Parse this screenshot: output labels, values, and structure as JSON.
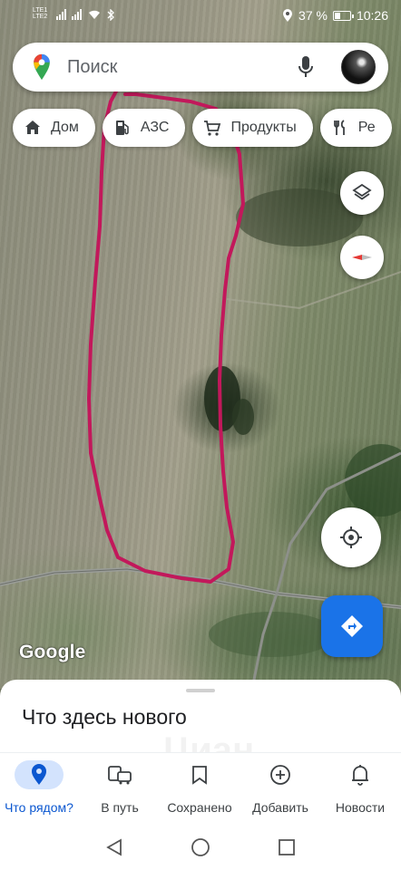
{
  "status_bar": {
    "sim1": "LTE1",
    "sim2": "LTE2",
    "battery": "37 %",
    "time": "10:26"
  },
  "search": {
    "placeholder": "Поиск"
  },
  "chips": [
    {
      "label": "Дом",
      "icon": "home-icon"
    },
    {
      "label": "АЗС",
      "icon": "gas-station-icon"
    },
    {
      "label": "Продукты",
      "icon": "cart-icon"
    },
    {
      "label": "Ре",
      "icon": "restaurant-icon"
    }
  ],
  "map": {
    "attribution": "Google",
    "annotation_color": "#c2185b"
  },
  "sheet": {
    "title": "Что здесь нового",
    "watermark": "Циан"
  },
  "bottom_nav": [
    {
      "label": "Что рядом?",
      "icon": "location-pin-icon",
      "active": true
    },
    {
      "label": "В путь",
      "icon": "commute-icon",
      "active": false
    },
    {
      "label": "Сохранено",
      "icon": "bookmark-icon",
      "active": false
    },
    {
      "label": "Добавить",
      "icon": "add-circle-icon",
      "active": false
    },
    {
      "label": "Новости",
      "icon": "bell-icon",
      "active": false
    }
  ],
  "colors": {
    "accent": "#1a73e8",
    "active_pill": "#d3e3fd",
    "active_text": "#0b57d0"
  }
}
